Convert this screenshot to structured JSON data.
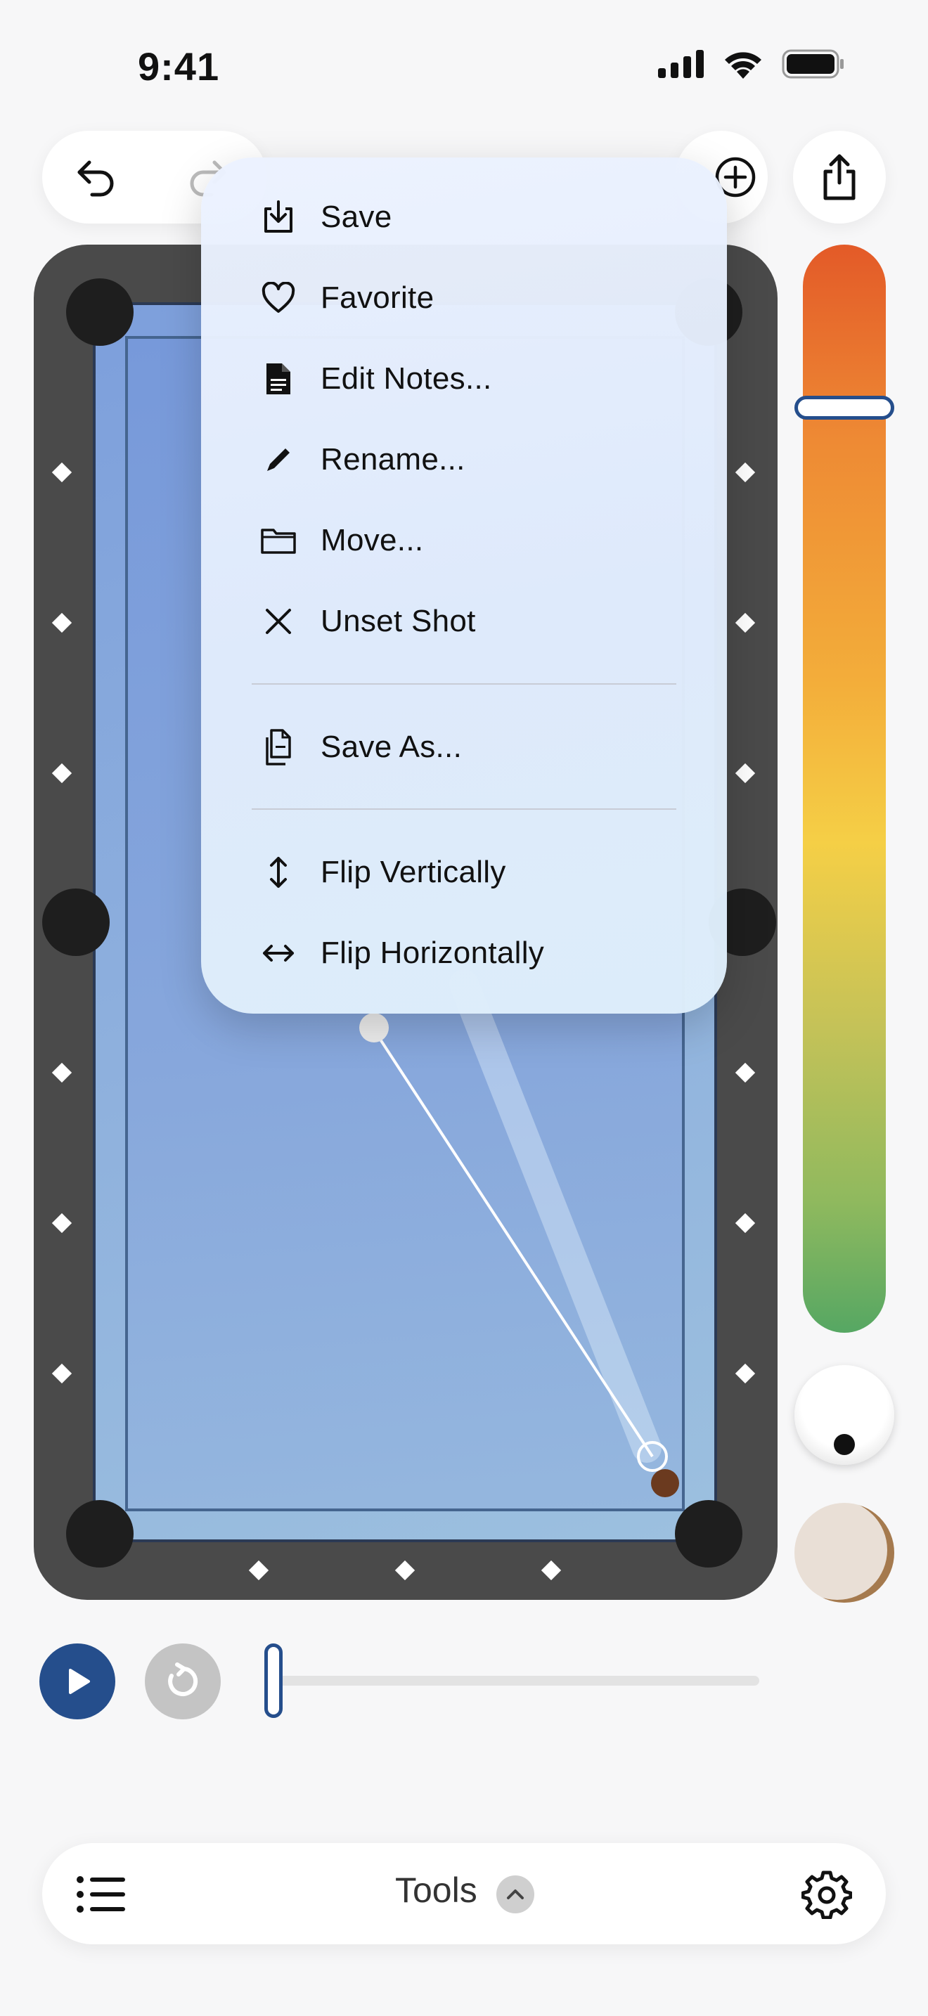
{
  "status_bar": {
    "time": "9:41"
  },
  "toolbar": {
    "undo": "undo-arrow-icon",
    "redo": "redo-arrow-icon",
    "add": "plus-circle-icon",
    "share": "share-icon"
  },
  "menu": {
    "items": [
      {
        "label": "Save",
        "icon": "save-download-icon"
      },
      {
        "label": "Favorite",
        "icon": "heart-icon"
      },
      {
        "label": "Edit Notes...",
        "icon": "document-icon"
      },
      {
        "label": "Rename...",
        "icon": "pencil-icon"
      },
      {
        "label": "Move...",
        "icon": "folder-icon"
      },
      {
        "label": "Unset Shot",
        "icon": "x-icon"
      },
      {
        "label": "Save As...",
        "icon": "copy-docs-icon"
      },
      {
        "label": "Flip Vertically",
        "icon": "vertical-arrows-icon"
      },
      {
        "label": "Flip Horizontally",
        "icon": "horizontal-arrows-icon"
      }
    ]
  },
  "power": {
    "level": 0.85
  },
  "playback": {
    "progress": 0.0
  },
  "bottom_bar": {
    "tools_label": "Tools"
  },
  "colors": {
    "accent": "#254e8c",
    "table_frame": "#4a4a4a",
    "cloth": "#87a7dc",
    "power_top": "#e35a28",
    "power_bottom": "#56a763"
  }
}
